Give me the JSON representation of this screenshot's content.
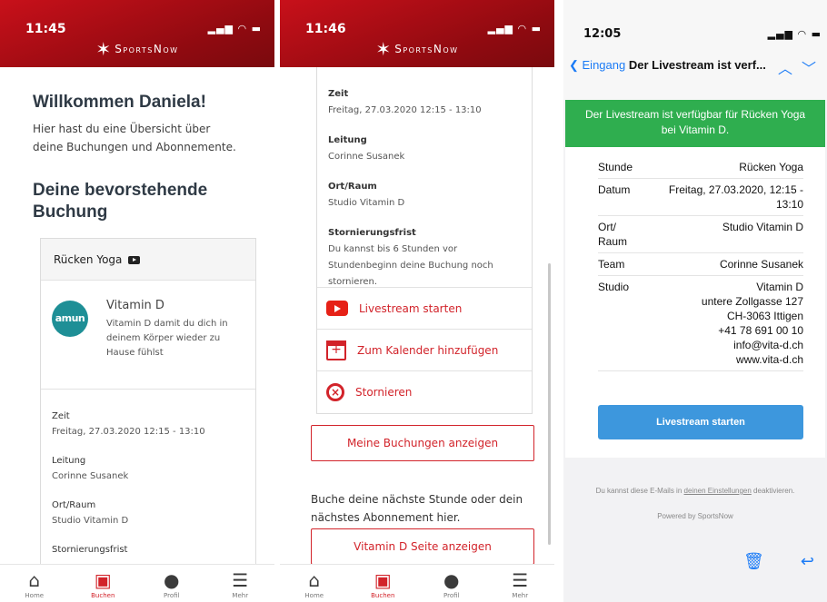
{
  "brand": {
    "name": "SportsNow",
    "accent": "#d2232a"
  },
  "phone1": {
    "time": "11:45",
    "title": "Willkommen Daniela!",
    "subtitle": "Hier hast du eine Übersicht über deine Buchungen und Abonnemente.",
    "section_title": "Deine bevorstehende Buchung",
    "card": {
      "class_name": "Rücken Yoga",
      "studio_logo_text": "amun",
      "studio_name": "Vitamin D",
      "studio_desc": "Vitamin D damit du dich in deinem Körper wieder zu Hause fühlst",
      "info": [
        {
          "label": "Zeit",
          "value": "Freitag, 27.03.2020 12:15 - 13:10"
        },
        {
          "label": "Leitung",
          "value": "Corinne Susanek"
        },
        {
          "label": "Ort/Raum",
          "value": "Studio Vitamin D"
        },
        {
          "label": "Stornierungsfrist",
          "value": ""
        }
      ]
    }
  },
  "phone2": {
    "time": "11:46",
    "info": [
      {
        "label": "Zeit",
        "value": "Freitag, 27.03.2020 12:15 - 13:10"
      },
      {
        "label": "Leitung",
        "value": "Corinne Susanek"
      },
      {
        "label": "Ort/Raum",
        "value": "Studio Vitamin D"
      },
      {
        "label": "Stornierungsfrist",
        "value": "Du kannst bis 6 Stunden vor Stundenbeginn deine Buchung noch stornieren."
      }
    ],
    "actions": {
      "livestream": "Livestream starten",
      "calendar": "Zum Kalender hinzufügen",
      "cancel": "Stornieren"
    },
    "my_bookings_button": "Meine Buchungen anzeigen",
    "next_text": "Buche deine nächste Stunde oder dein nächstes Abonnement hier.",
    "studio_page_button": "Vitamin D Seite anzeigen"
  },
  "tabbar": [
    {
      "label": "Home",
      "icon": "home-icon"
    },
    {
      "label": "Buchen",
      "icon": "calendar-icon"
    },
    {
      "label": "Profil",
      "icon": "user-icon"
    },
    {
      "label": "Mehr",
      "icon": "menu-icon"
    }
  ],
  "mail": {
    "time": "12:05",
    "back_label": "Eingang",
    "subject": "Der Livestream ist verf...",
    "banner": "Der Livestream ist verfügbar für Rücken Yoga bei Vitamin D.",
    "banner_color": "#2fae4f",
    "rows": [
      {
        "label": "Stunde",
        "value": "Rücken Yoga"
      },
      {
        "label": "Datum",
        "value": "Freitag, 27.03.2020, 12:15 - 13:10"
      },
      {
        "label": "Ort/ Raum",
        "value": "Studio Vitamin D"
      },
      {
        "label": "Team",
        "value": "Corinne Susanek"
      },
      {
        "label": "Studio",
        "value": "Vitamin D\nuntere Zollgasse 127\nCH-3063 Ittigen\n+41 78 691 00 10\ninfo@vita-d.ch\nwww.vita-d.ch"
      }
    ],
    "button": "Livestream starten",
    "button_color": "#3d97dd",
    "footer_pre": "Du kannst diese E-Mails in",
    "footer_link": "deinen Einstellungen",
    "footer_post": "deaktivieren.",
    "powered": "Powered by SportsNow"
  }
}
